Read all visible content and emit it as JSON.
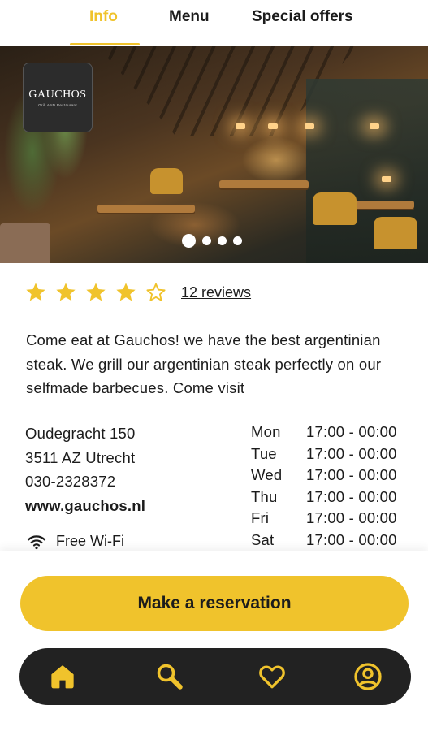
{
  "tabs": [
    {
      "label": "Info",
      "active": true
    },
    {
      "label": "Menu",
      "active": false
    },
    {
      "label": "Special offers",
      "active": false
    }
  ],
  "logo": {
    "name": "GAUCHOS",
    "subtitle": "Grill AND Restaurant"
  },
  "carousel": {
    "pages": 4,
    "active_index": 0
  },
  "rating": {
    "stars_filled": 4,
    "stars_total": 5,
    "reviews_label": "12 reviews"
  },
  "description": "Come eat at Gauchos! we have the best argentinian steak. We grill our argentinian steak perfectly on our selfmade barbecues. Come visit",
  "contact": {
    "address_line1": "Oudegracht 150",
    "address_line2": "3511 AZ Utrecht",
    "phone": "030-2328372",
    "website": "www.gauchos.nl"
  },
  "amenities": [
    {
      "icon": "wifi-icon",
      "label": "Free Wi-Fi"
    }
  ],
  "hours": [
    {
      "day": "Mon",
      "time": "17:00 - 00:00"
    },
    {
      "day": "Tue",
      "time": "17:00 - 00:00"
    },
    {
      "day": "Wed",
      "time": "17:00 - 00:00"
    },
    {
      "day": "Thu",
      "time": "17:00 - 00:00"
    },
    {
      "day": "Fri",
      "time": "17:00 - 00:00"
    },
    {
      "day": "Sat",
      "time": "17:00 - 00:00"
    }
  ],
  "reserve_button": "Make a reservation",
  "bottom_nav": [
    {
      "icon": "home-icon",
      "active": true
    },
    {
      "icon": "search-icon",
      "active": false
    },
    {
      "icon": "heart-icon",
      "active": false
    },
    {
      "icon": "profile-icon",
      "active": false
    }
  ],
  "colors": {
    "accent": "#f0c32c",
    "dark": "#222222",
    "text": "#1c1c1c"
  }
}
